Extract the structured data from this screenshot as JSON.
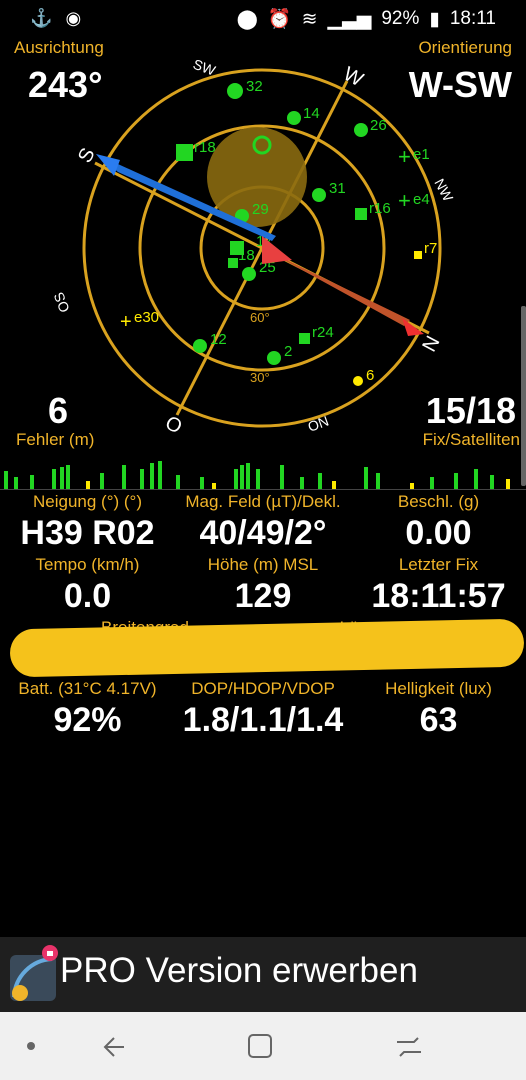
{
  "status_bar": {
    "battery": "92%",
    "time": "18:11"
  },
  "header": {
    "left_label": "Ausrichtung",
    "left_value": "243°",
    "right_label": "Orientierung",
    "right_value": "W-SW"
  },
  "compass": {
    "directions": [
      "SW",
      "W",
      "NW",
      "N",
      "ON",
      "O",
      "OS",
      "S"
    ],
    "ring_labels": [
      "60°",
      "30°"
    ],
    "satellites": [
      "32",
      "14",
      "26",
      "r18",
      "e1",
      "e4",
      "31",
      "r16",
      "29",
      "r7",
      "17",
      "18",
      "25",
      "e30",
      "12",
      "r24",
      "2",
      "6"
    ]
  },
  "radar_stats": {
    "errors_value": "6",
    "errors_label": "Fehler (m)",
    "fix_value": "15/18",
    "fix_label": "Fix/Satelliten"
  },
  "row1": {
    "c1_h": "Neigung (°) (°)",
    "c1_v": "H39 R02",
    "c2_h": "Mag. Feld (µT)/Dekl.",
    "c2_v": "40/49/2°",
    "c3_h": "Beschl. (g)",
    "c3_v": "0.00"
  },
  "row2": {
    "c1_h": "Tempo (km/h)",
    "c1_v": "0.0",
    "c2_h": "Höhe (m) MSL",
    "c2_v": "129",
    "c3_h": "Letzter Fix",
    "c3_v": "18:11:57"
  },
  "row3": {
    "c1_h": "Breitengrad",
    "c3_h": "Längengrad"
  },
  "row4": {
    "c1_h": "Batt. (31°C 4.17V)",
    "c1_v": "92%",
    "c2_h": "DOP/HDOP/VDOP",
    "c2_v": "1.8/1.1/1.4",
    "c3_h": "Helligkeit (lux)",
    "c3_v": "63"
  },
  "pro_banner": {
    "label": "PRO Version erwerben"
  },
  "colors": {
    "accent": "#f0b42a",
    "satellite": "#22d622",
    "background": "#000000"
  }
}
